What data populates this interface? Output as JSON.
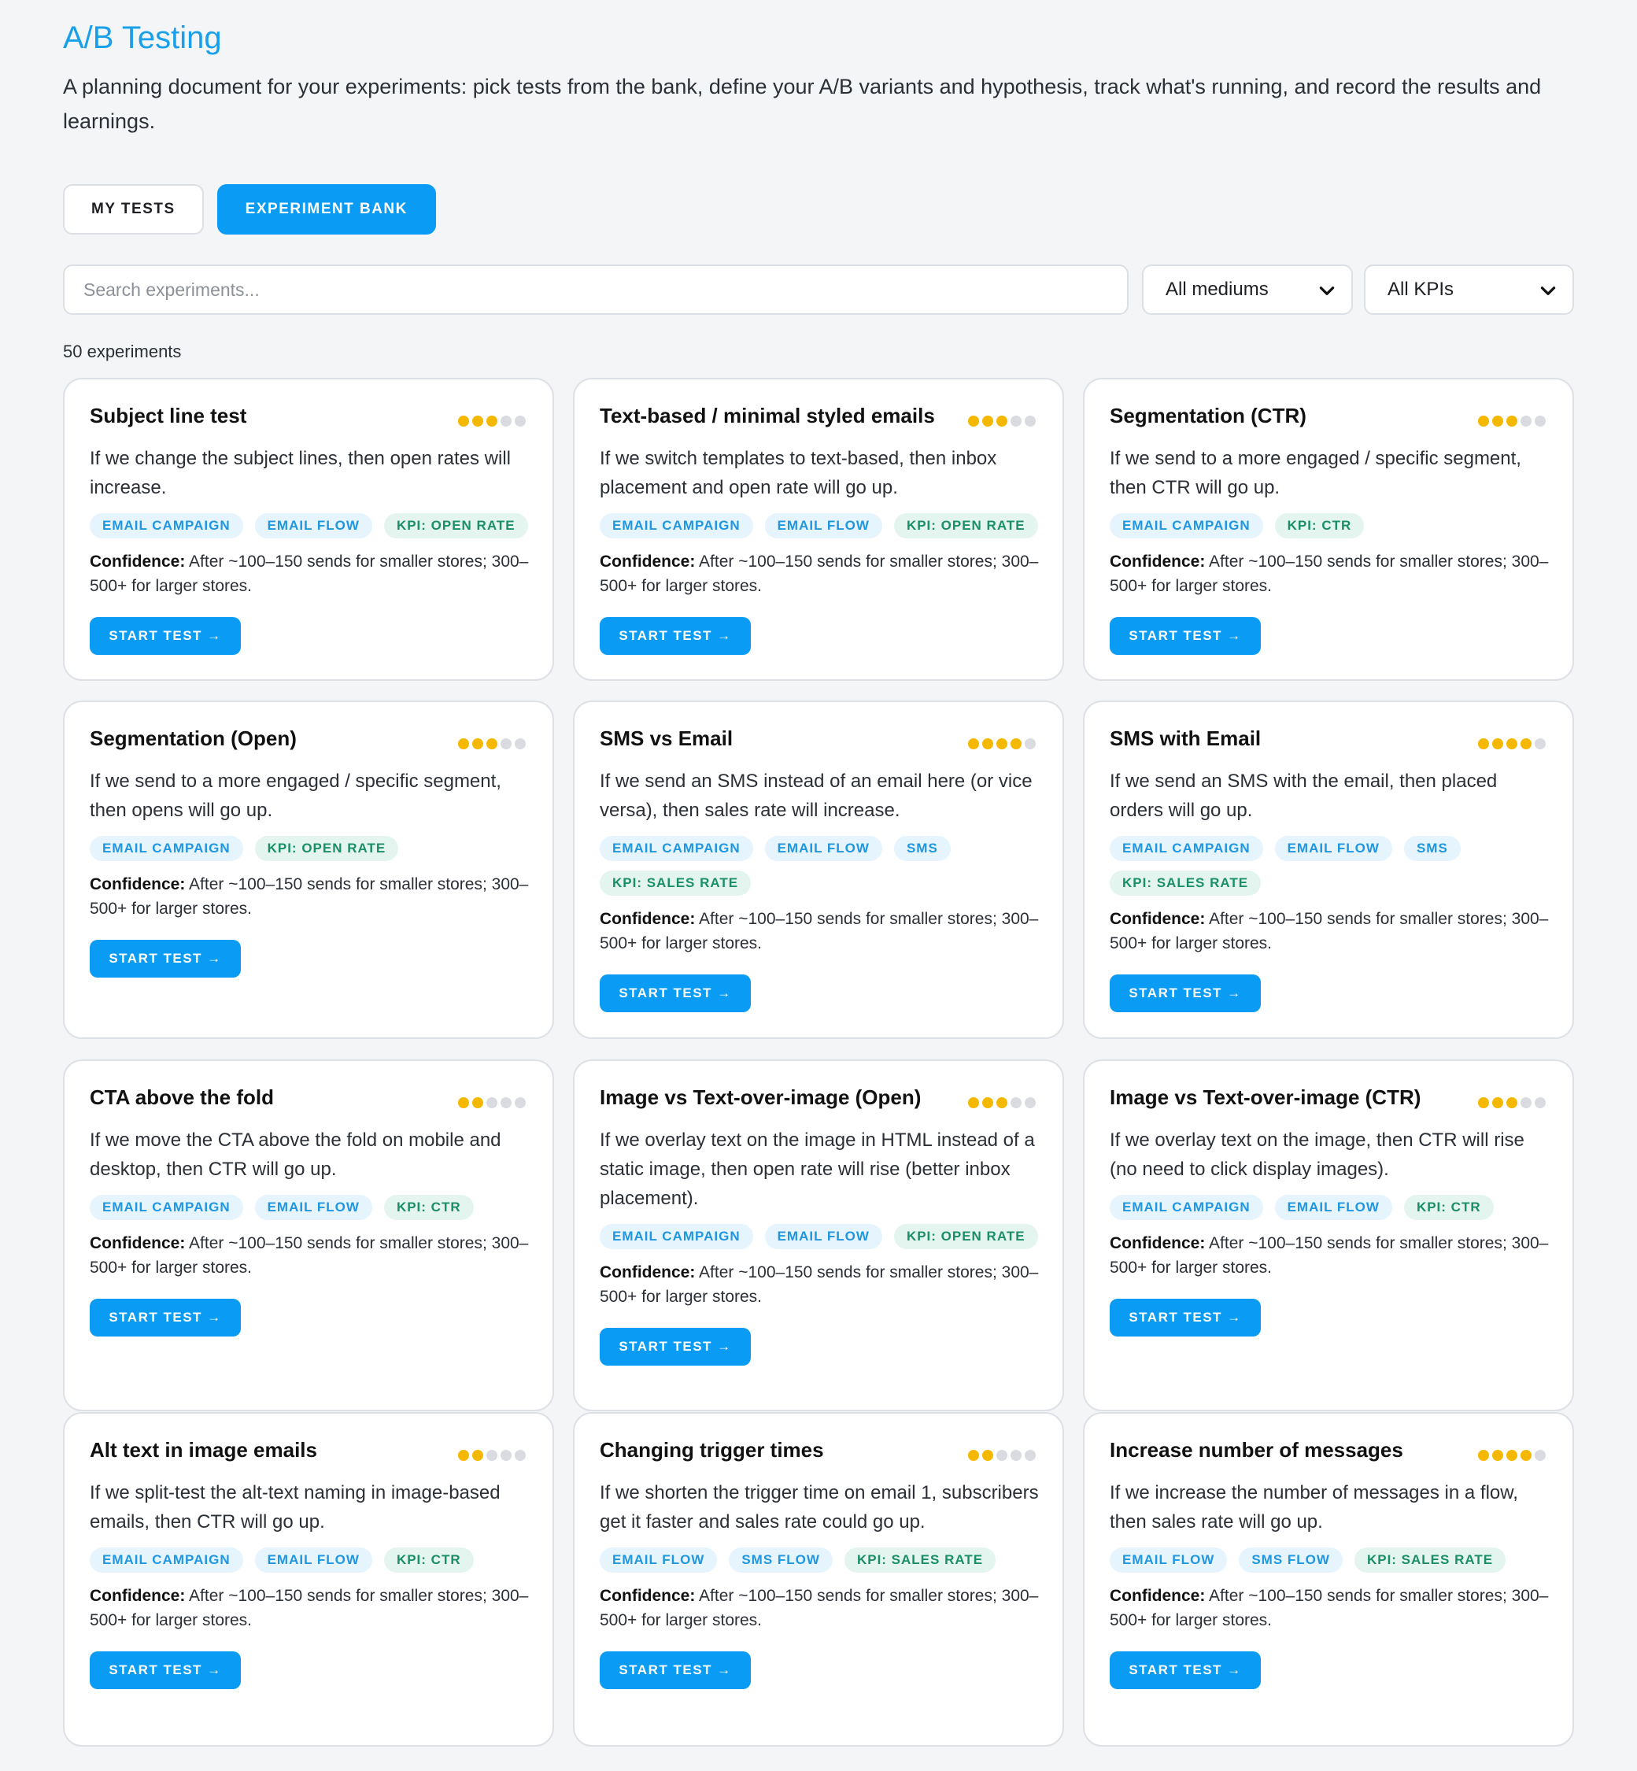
{
  "page": {
    "title": "A/B Testing",
    "subtitle": "A planning document for your experiments: pick tests from the bank, define your A/B variants and hypothesis, track what's running, and record the results and learnings."
  },
  "tabs": [
    {
      "label": "MY TESTS",
      "active": false
    },
    {
      "label": "EXPERIMENT BANK",
      "active": true
    }
  ],
  "filters": {
    "search_placeholder": "Search experiments...",
    "medium_select": "All mediums",
    "kpi_select": "All KPIs"
  },
  "count_label": "50 experiments",
  "confidence_label": "Confidence:",
  "start_label": "START TEST →",
  "colors": {
    "accent": "#0a9bf5",
    "title": "#1aa0e8",
    "dot_on": "#f5b800",
    "dot_off": "#d9dbe0"
  },
  "experiments": [
    {
      "title": "Subject line test",
      "difficulty": 3,
      "hypothesis": "If we change the subject lines, then open rates will increase.",
      "tags": [
        {
          "text": "EMAIL CAMPAIGN",
          "kind": "medium"
        },
        {
          "text": "EMAIL FLOW",
          "kind": "medium"
        },
        {
          "text": "KPI: OPEN RATE",
          "kind": "kpi"
        }
      ],
      "confidence": "After ~100–150 sends for smaller stores; 300–500+ for larger stores."
    },
    {
      "title": "Text-based / minimal styled emails",
      "difficulty": 3,
      "hypothesis": "If we switch templates to text-based, then inbox placement and open rate will go up.",
      "tags": [
        {
          "text": "EMAIL CAMPAIGN",
          "kind": "medium"
        },
        {
          "text": "EMAIL FLOW",
          "kind": "medium"
        },
        {
          "text": "KPI: OPEN RATE",
          "kind": "kpi"
        }
      ],
      "confidence": "After ~100–150 sends for smaller stores; 300–500+ for larger stores."
    },
    {
      "title": "Segmentation (CTR)",
      "difficulty": 3,
      "hypothesis": "If we send to a more engaged / specific segment, then CTR will go up.",
      "tags": [
        {
          "text": "EMAIL CAMPAIGN",
          "kind": "medium"
        },
        {
          "text": "KPI: CTR",
          "kind": "kpi"
        }
      ],
      "confidence": "After ~100–150 sends for smaller stores; 300–500+ for larger stores."
    },
    {
      "title": "Segmentation (Open)",
      "difficulty": 3,
      "hypothesis": "If we send to a more engaged / specific segment, then opens will go up.",
      "tags": [
        {
          "text": "EMAIL CAMPAIGN",
          "kind": "medium"
        },
        {
          "text": "KPI: OPEN RATE",
          "kind": "kpi"
        }
      ],
      "confidence": "After ~100–150 sends for smaller stores; 300–500+ for larger stores."
    },
    {
      "title": "SMS vs Email",
      "difficulty": 4,
      "hypothesis": "If we send an SMS instead of an email here (or vice versa), then sales rate will increase.",
      "tags": [
        {
          "text": "EMAIL CAMPAIGN",
          "kind": "medium"
        },
        {
          "text": "EMAIL FLOW",
          "kind": "medium"
        },
        {
          "text": "SMS",
          "kind": "medium"
        },
        {
          "text": "KPI: SALES RATE",
          "kind": "kpi"
        }
      ],
      "confidence": "After ~100–150 sends for smaller stores; 300–500+ for larger stores."
    },
    {
      "title": "SMS with Email",
      "difficulty": 4,
      "hypothesis": "If we send an SMS with the email, then placed orders will go up.",
      "tags": [
        {
          "text": "EMAIL CAMPAIGN",
          "kind": "medium"
        },
        {
          "text": "EMAIL FLOW",
          "kind": "medium"
        },
        {
          "text": "SMS",
          "kind": "medium"
        },
        {
          "text": "KPI: SALES RATE",
          "kind": "kpi"
        }
      ],
      "confidence": "After ~100–150 sends for smaller stores; 300–500+ for larger stores."
    },
    {
      "title": "CTA above the fold",
      "difficulty": 2,
      "hypothesis": "If we move the CTA above the fold on mobile and desktop, then CTR will go up.",
      "tags": [
        {
          "text": "EMAIL CAMPAIGN",
          "kind": "medium"
        },
        {
          "text": "EMAIL FLOW",
          "kind": "medium"
        },
        {
          "text": "KPI: CTR",
          "kind": "kpi"
        }
      ],
      "confidence": "After ~100–150 sends for smaller stores; 300–500+ for larger stores."
    },
    {
      "title": "Image vs Text-over-image (Open)",
      "difficulty": 3,
      "hypothesis": "If we overlay text on the image in HTML instead of a static image, then open rate will rise (better inbox placement).",
      "tags": [
        {
          "text": "EMAIL CAMPAIGN",
          "kind": "medium"
        },
        {
          "text": "EMAIL FLOW",
          "kind": "medium"
        },
        {
          "text": "KPI: OPEN RATE",
          "kind": "kpi"
        }
      ],
      "confidence": "After ~100–150 sends for smaller stores; 300–500+ for larger stores."
    },
    {
      "title": "Image vs Text-over-image (CTR)",
      "difficulty": 3,
      "hypothesis": "If we overlay text on the image, then CTR will rise (no need to click display images).",
      "tags": [
        {
          "text": "EMAIL CAMPAIGN",
          "kind": "medium"
        },
        {
          "text": "EMAIL FLOW",
          "kind": "medium"
        },
        {
          "text": "KPI: CTR",
          "kind": "kpi"
        }
      ],
      "confidence": "After ~100–150 sends for smaller stores; 300–500+ for larger stores."
    },
    {
      "title": "Alt text in image emails",
      "difficulty": 2,
      "hypothesis": "If we split-test the alt-text naming in image-based emails, then CTR will go up.",
      "tags": [
        {
          "text": "EMAIL CAMPAIGN",
          "kind": "medium"
        },
        {
          "text": "EMAIL FLOW",
          "kind": "medium"
        },
        {
          "text": "KPI: CTR",
          "kind": "kpi"
        }
      ],
      "confidence": "After ~100–150 sends for smaller stores; 300–500+ for larger stores."
    },
    {
      "title": "Changing trigger times",
      "difficulty": 2,
      "hypothesis": "If we shorten the trigger time on email 1, subscribers get it faster and sales rate could go up.",
      "tags": [
        {
          "text": "EMAIL FLOW",
          "kind": "medium"
        },
        {
          "text": "SMS FLOW",
          "kind": "medium"
        },
        {
          "text": "KPI: SALES RATE",
          "kind": "kpi"
        }
      ],
      "confidence": "After ~100–150 sends for smaller stores; 300–500+ for larger stores."
    },
    {
      "title": "Increase number of messages",
      "difficulty": 4,
      "hypothesis": "If we increase the number of messages in a flow, then sales rate will go up.",
      "tags": [
        {
          "text": "EMAIL FLOW",
          "kind": "medium"
        },
        {
          "text": "SMS FLOW",
          "kind": "medium"
        },
        {
          "text": "KPI: SALES RATE",
          "kind": "kpi"
        }
      ],
      "confidence": "After ~100–150 sends for smaller stores; 300–500+ for larger stores."
    }
  ]
}
